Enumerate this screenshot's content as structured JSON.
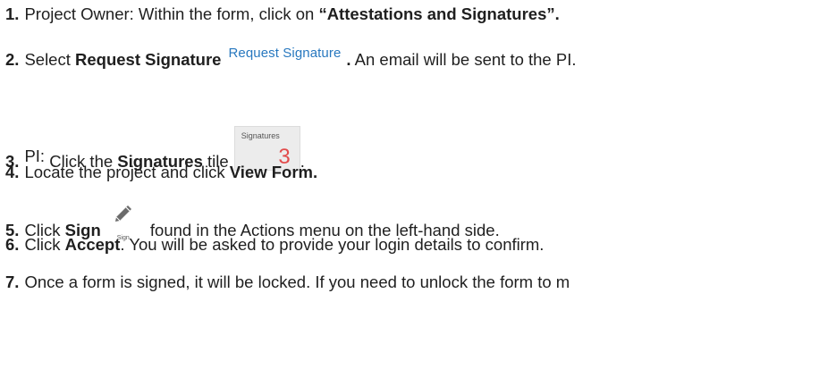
{
  "steps": [
    {
      "num": "1.",
      "pre": "Project Owner: Within the form, click on ",
      "bold": "“Attestations and Signatures”."
    },
    {
      "num": "2.",
      "pre": "Select ",
      "bold": "Request Signature",
      "button_label": "Request Signature",
      "bold_period": ".",
      "post": " An email will be sent to the PI."
    },
    {
      "num": "3.",
      "role": "PI:",
      "pre": " Click the ",
      "bold": "Signatures",
      "post": " tile",
      "tile_title": "Signatures",
      "tile_count": "3",
      "tail": "."
    },
    {
      "num": "4.",
      "pre": "Locate the project and click ",
      "bold": "View Form."
    },
    {
      "num": "5.",
      "pre": "Click ",
      "bold": "Sign",
      "icon_label": "Sign",
      "post": " found in the Actions menu on the left-hand side."
    },
    {
      "num": "6.",
      "pre": "Click ",
      "bold": "Accept",
      "post": ". You will be asked to provide your login details to confirm."
    },
    {
      "num": "7.",
      "pre": "Once a form is signed, it will be locked. If you need to unlock the form to m"
    }
  ],
  "colors": {
    "text": "#1f1f1f",
    "request_signature_link": "#2878bf",
    "tile_background": "#ececec",
    "tile_count": "#e24b4b"
  },
  "icons": {
    "sign": "pencil-icon"
  }
}
